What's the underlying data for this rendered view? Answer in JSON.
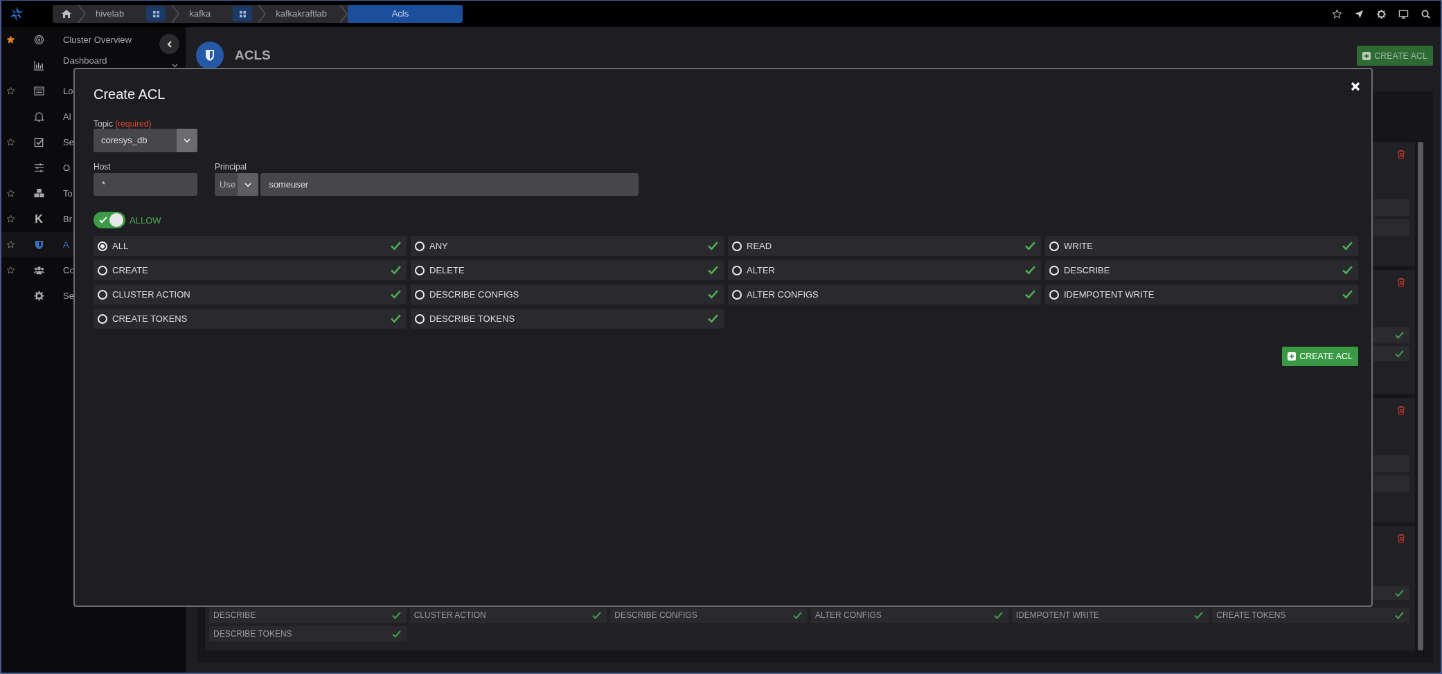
{
  "breadcrumb": {
    "items": [
      {
        "label": "hivelab",
        "grid": true,
        "selected": false
      },
      {
        "label": "kafka",
        "grid": true,
        "selected": false
      },
      {
        "label": "kafkakraftlab",
        "grid": false,
        "selected": false
      },
      {
        "label": "Acls",
        "grid": false,
        "selected": true
      }
    ]
  },
  "sidebar": {
    "items": [
      {
        "label": "Cluster Overview",
        "kind": "pinned",
        "expandable": false,
        "selected": false
      },
      {
        "label": "Dashboard",
        "kind": "plain",
        "expandable": true,
        "selected": false
      },
      {
        "label": "Lo",
        "kind": "unpinned",
        "expandable": false,
        "selected": false
      },
      {
        "label": "Al",
        "kind": "plain",
        "expandable": false,
        "selected": false
      },
      {
        "label": "Se",
        "kind": "unpinned",
        "expandable": false,
        "selected": false
      },
      {
        "label": "O",
        "kind": "plain",
        "expandable": false,
        "selected": false
      },
      {
        "label": "To",
        "kind": "unpinned",
        "expandable": false,
        "selected": false
      },
      {
        "label": "Br",
        "kind": "unpinned",
        "expandable": false,
        "selected": false,
        "glyph": "K"
      },
      {
        "label": "A",
        "kind": "unpinned",
        "expandable": false,
        "selected": true
      },
      {
        "label": "Co",
        "kind": "unpinned",
        "expandable": false,
        "selected": false
      },
      {
        "label": "Se",
        "kind": "plain",
        "expandable": false,
        "selected": false
      }
    ]
  },
  "page": {
    "title": "ACLS",
    "create_button": "CREATE ACL",
    "visible_permissions": [
      {
        "label": "DESCRIBE",
        "allowed": true
      },
      {
        "label": "CLUSTER ACTION",
        "allowed": true
      },
      {
        "label": "DESCRIBE CONFIGS",
        "allowed": true
      },
      {
        "label": "ALTER CONFIGS",
        "allowed": true
      },
      {
        "label": "IDEMPOTENT WRITE",
        "allowed": true
      },
      {
        "label": "CREATE TOKENS",
        "allowed": true
      },
      {
        "label": "DESCRIBE TOKENS",
        "allowed": true
      }
    ]
  },
  "modal": {
    "title": "Create ACL",
    "topic": {
      "label": "Topic",
      "note": "(required)",
      "value": "coresys_db"
    },
    "host": {
      "label": "Host",
      "value": "*"
    },
    "principal": {
      "label": "Principal",
      "type": "Use",
      "value": "someuser"
    },
    "allow": {
      "label": "ALLOW",
      "on": true
    },
    "operations": [
      {
        "label": "ALL",
        "selected": true,
        "allowed": true
      },
      {
        "label": "ANY",
        "selected": false,
        "allowed": true
      },
      {
        "label": "READ",
        "selected": false,
        "allowed": true
      },
      {
        "label": "WRITE",
        "selected": false,
        "allowed": true
      },
      {
        "label": "CREATE",
        "selected": false,
        "allowed": true
      },
      {
        "label": "DELETE",
        "selected": false,
        "allowed": true
      },
      {
        "label": "ALTER",
        "selected": false,
        "allowed": true
      },
      {
        "label": "DESCRIBE",
        "selected": false,
        "allowed": true
      },
      {
        "label": "CLUSTER ACTION",
        "selected": false,
        "allowed": true
      },
      {
        "label": "DESCRIBE CONFIGS",
        "selected": false,
        "allowed": true
      },
      {
        "label": "ALTER CONFIGS",
        "selected": false,
        "allowed": true
      },
      {
        "label": "IDEMPOTENT WRITE",
        "selected": false,
        "allowed": true
      },
      {
        "label": "CREATE TOKENS",
        "selected": false,
        "allowed": true
      },
      {
        "label": "DESCRIBE TOKENS",
        "selected": false,
        "allowed": true
      }
    ],
    "submit": "CREATE ACL"
  }
}
